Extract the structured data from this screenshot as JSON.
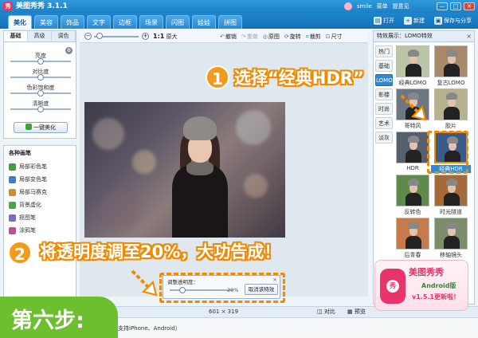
{
  "window": {
    "title": "美图秀秀 3.1.1",
    "icon_text": "秀",
    "user": {
      "name": "smile",
      "menu": "菜单",
      "help": "提意见"
    },
    "buttons": {
      "minimize": "—",
      "maximize": "□",
      "close": "✕"
    }
  },
  "tabs": [
    "美化",
    "美容",
    "饰品",
    "文字",
    "边框",
    "场景",
    "闪图",
    "娃娃",
    "拼图"
  ],
  "active_tab": "美化",
  "top_actions": {
    "open": "打开",
    "new": "新建",
    "save_share": "保存与分享"
  },
  "left": {
    "sub_tabs": [
      "基础",
      "高级",
      "调色"
    ],
    "sliders": [
      {
        "label": "亮度",
        "value": 0.5
      },
      {
        "label": "对比度",
        "value": 0.5
      },
      {
        "label": "色彩饱和度",
        "value": 0.5
      },
      {
        "label": "清晰度",
        "value": 0.5
      }
    ],
    "one_key_button": "一键美化",
    "brush_title": "各种画笔",
    "brushes": [
      {
        "label": "局部彩色笔",
        "color": "#3da43d"
      },
      {
        "label": "局部变色笔",
        "color": "#3b7fd1"
      },
      {
        "label": "局部马赛克",
        "color": "#d98a2b"
      },
      {
        "label": "背景虚化",
        "color": "#4aa64a"
      },
      {
        "label": "抠图笔",
        "color": "#7a6ac9"
      },
      {
        "label": "涂鸦笔",
        "color": "#c94a8c"
      }
    ]
  },
  "canvas_toolbar": {
    "actual_size_ratio": "1:1",
    "actual_size_label": "原大",
    "tools": [
      {
        "label": "撤销",
        "icon": "↶",
        "enabled": true
      },
      {
        "label": "重做",
        "icon": "↷",
        "enabled": false
      },
      {
        "label": "原图",
        "icon": "◎",
        "enabled": true
      },
      {
        "label": "旋转",
        "icon": "⟳",
        "enabled": true
      },
      {
        "label": "裁剪",
        "icon": "⌗",
        "enabled": true
      },
      {
        "label": "尺寸",
        "icon": "⊡",
        "enabled": true
      }
    ],
    "zoom_level": 0.05
  },
  "right_panel": {
    "header": "特效展示：LOMO特效",
    "close": "×",
    "categories": [
      "热门",
      "基础",
      "LOMO",
      "影楼",
      "时尚",
      "艺术",
      "淡灰"
    ],
    "active_category": "LOMO",
    "effects": [
      {
        "label": "经典LOMO",
        "tint": "#b9c5a5"
      },
      {
        "label": "复古LOMO",
        "tint": "#a88a6a"
      },
      {
        "label": "哥特风",
        "tint": "#6d7782"
      },
      {
        "label": "胶片",
        "tint": "#b7b28e"
      },
      {
        "label": "HDR",
        "tint": "#55606e"
      },
      {
        "label": "经典HDR",
        "tint": "#3c5a88"
      },
      {
        "label": "反转色",
        "tint": "#5e8a4a"
      },
      {
        "label": "时光隧道",
        "tint": "#a56a3a"
      },
      {
        "label": "后青春",
        "tint": "#c77a4a"
      },
      {
        "label": "移轴镜头",
        "tint": "#7b8e6a"
      }
    ],
    "selected_effect": "经典HDR"
  },
  "opacity_dialog": {
    "title": "调整透明度：",
    "value_text": "20%",
    "value": 0.2,
    "cancel_button": "取消该特效",
    "close": "×"
  },
  "status": {
    "dimensions": "601 × 319",
    "compare": "对比",
    "preview": "预览",
    "bottom_text": "支持iPhone、Android）"
  },
  "annotations": {
    "step1_number": "1",
    "step1_text": "选择“经典HDR”",
    "step2_number": "2",
    "step2_text": "将透明度调至20%，大功告成！",
    "step_banner": "第六步:"
  },
  "promo": {
    "title": "美图秀秀",
    "subtitle": "Android版",
    "version": "v1.5.1更新啦！",
    "icon_text": "秀"
  }
}
